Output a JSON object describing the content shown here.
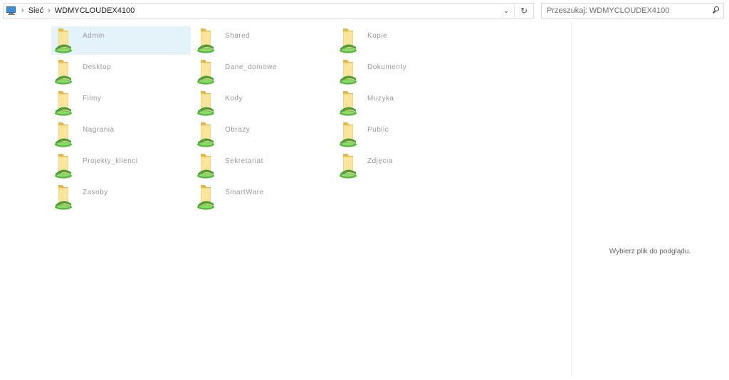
{
  "address": {
    "crumbs": [
      "Sieć",
      "WDMYCLOUDEX4100"
    ]
  },
  "search": {
    "placeholder": "Przeszukaj: WDMYCLOUDEX4100"
  },
  "folders": [
    {
      "name": "Admin",
      "selected": true
    },
    {
      "name": "Shared"
    },
    {
      "name": "Kopie"
    },
    {
      "name": "Desktop"
    },
    {
      "name": "Dane_domowe"
    },
    {
      "name": "Dokumenty"
    },
    {
      "name": "Filmy"
    },
    {
      "name": "Kody"
    },
    {
      "name": "Muzyka"
    },
    {
      "name": "Nagrania"
    },
    {
      "name": "Obrazy"
    },
    {
      "name": "Public"
    },
    {
      "name": "Projekty_klienci"
    },
    {
      "name": "Sekretariat"
    },
    {
      "name": "Zdjęcia"
    },
    {
      "name": "Zasoby"
    },
    {
      "name": "SmartWare"
    }
  ],
  "preview": {
    "message": "Wybierz plik do podglądu."
  }
}
